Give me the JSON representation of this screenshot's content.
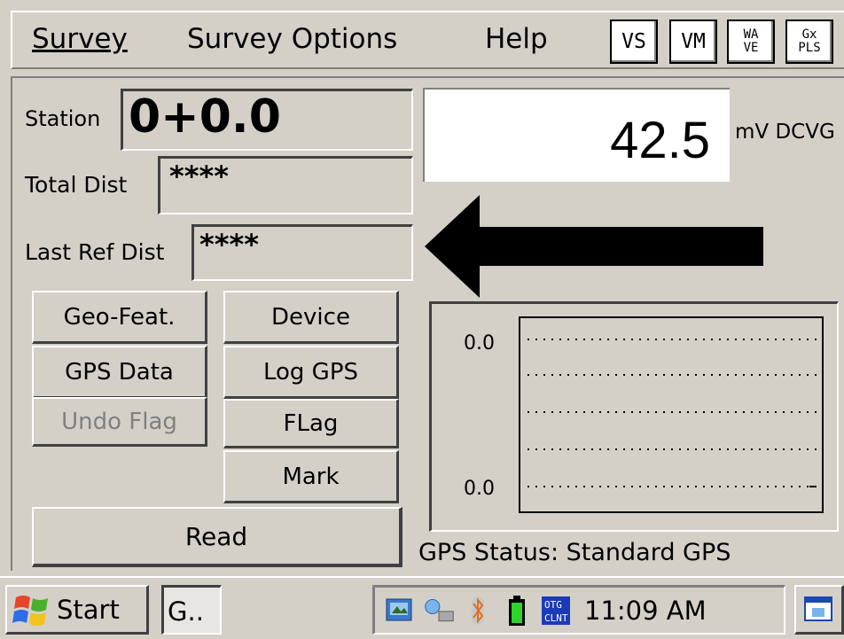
{
  "menu": {
    "survey": "Survey",
    "survey_options": "Survey Options",
    "help": "Help"
  },
  "toolbar": {
    "vs": "VS",
    "vm": "VM",
    "wave_top": "WA",
    "wave_bottom": "VE",
    "gxpls_top": "Gx",
    "gxpls_bottom": "PLS"
  },
  "fields": {
    "station_label": "Station",
    "station_value": "0+0.0",
    "total_dist_label": "Total Dist",
    "total_dist_value": "****",
    "last_ref_dist_label": "Last Ref Dist",
    "last_ref_dist_value": "****"
  },
  "reading": {
    "value": "42.5",
    "unit": "mV DCVG"
  },
  "buttons": {
    "geo_feat": "Geo-Feat.",
    "device": "Device",
    "gps_data": "GPS Data",
    "log_gps": "Log GPS",
    "undo_flag": "Undo Flag",
    "flag": "FLag",
    "mark": "Mark",
    "read": "Read"
  },
  "plot": {
    "y_top": "0.0",
    "y_bottom": "0.0"
  },
  "status": "GPS Status: Standard GPS",
  "taskbar": {
    "start": "Start",
    "task": "G..",
    "time": "11:09 AM"
  },
  "colors": {
    "window_gray": "#d4d0c8",
    "arrow": "#000000"
  },
  "icons": [
    "windows-logo-icon",
    "network-icon",
    "bluetooth-icon",
    "battery-icon",
    "otg-client-icon",
    "desktop-icon"
  ]
}
